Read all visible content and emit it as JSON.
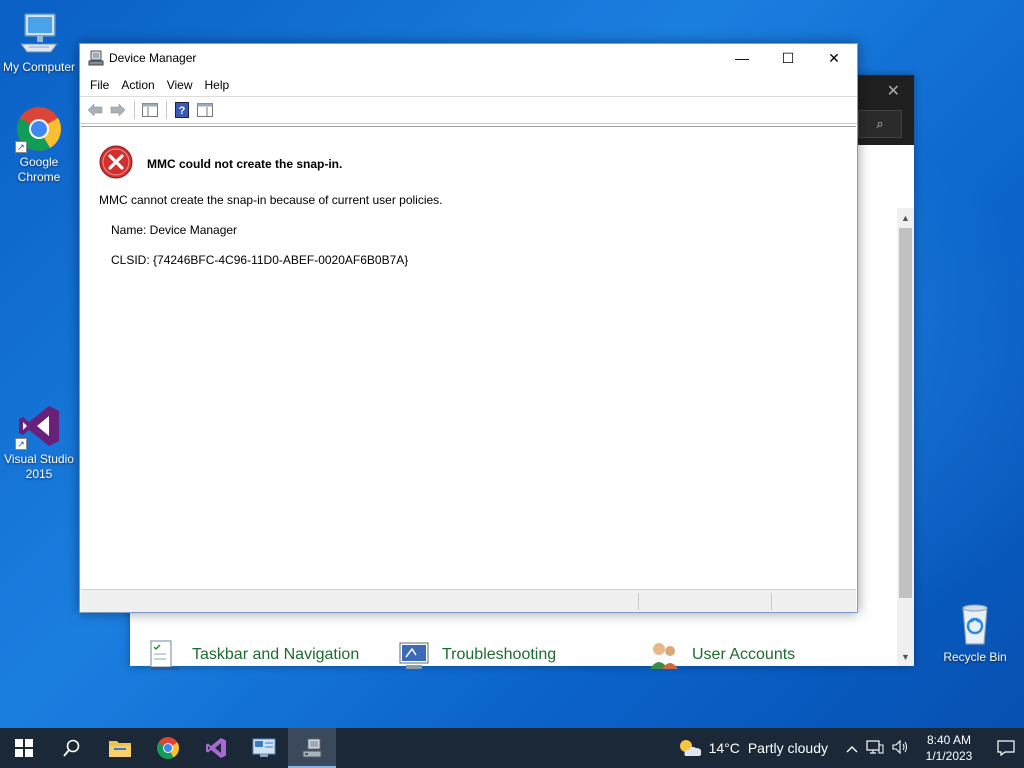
{
  "desktop": {
    "icons": [
      {
        "label": "My Computer"
      },
      {
        "label": "Google Chrome"
      },
      {
        "label": "Visual Studio 2015"
      },
      {
        "label": "Recycle Bin"
      }
    ]
  },
  "background_window": {
    "items": [
      {
        "label": "Taskbar and Navigation"
      },
      {
        "label": "Troubleshooting"
      },
      {
        "label": "User Accounts"
      }
    ]
  },
  "device_manager": {
    "title": "Device Manager",
    "menu": [
      "File",
      "Action",
      "View",
      "Help"
    ],
    "window_buttons": {
      "minimize": "—",
      "maximize": "☐",
      "close": "✕"
    },
    "error": {
      "title": "MMC could not create the snap-in.",
      "message": "MMC cannot create the snap-in because of current user policies.",
      "name_line": "Name: Device Manager",
      "clsid_line": "CLSID: {74246BFC-4C96-11D0-ABEF-0020AF6B0B7A}"
    }
  },
  "taskbar": {
    "weather": {
      "temp": "14°C",
      "condition": "Partly cloudy"
    },
    "clock": {
      "time": "8:40 AM",
      "date": "1/1/2023"
    }
  },
  "colors": {
    "desktop": "#1565c0",
    "taskbar": "#1b2838",
    "error_red": "#d32f2f",
    "link_green": "#1e6b2f"
  }
}
